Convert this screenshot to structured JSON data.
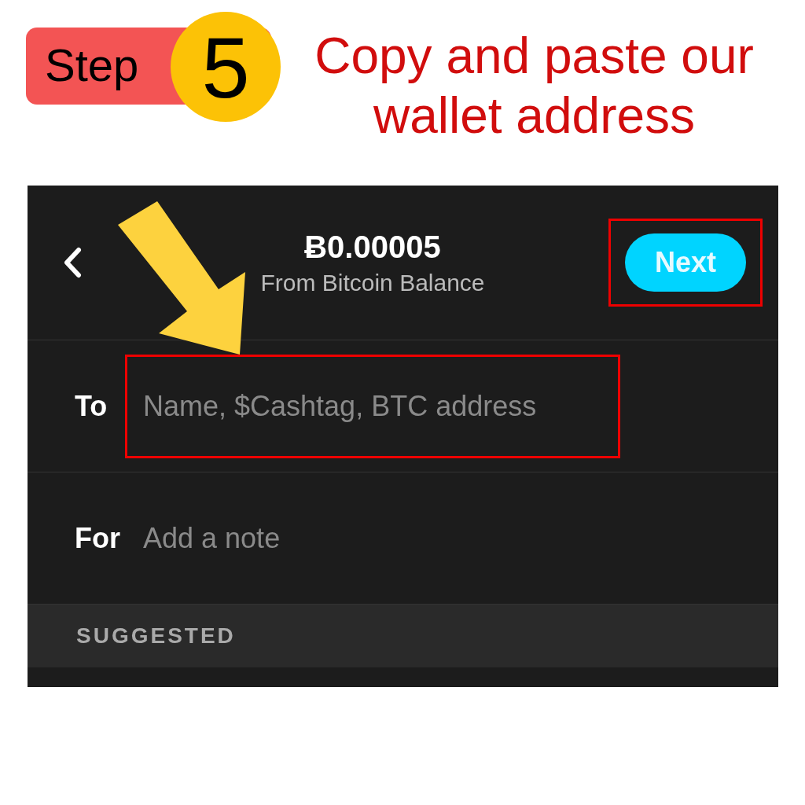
{
  "step_badge": {
    "label": "Step",
    "number": "5"
  },
  "headline": "Copy and paste our wallet address",
  "screen": {
    "amount": "Ƀ0.00005",
    "source": "From Bitcoin Balance",
    "next_button": {
      "label": "Next",
      "disabled": true,
      "highlighted": true
    },
    "fields": [
      {
        "label": "To",
        "placeholder": "Name, $Cashtag, BTC address",
        "highlighted": true
      },
      {
        "label": "For",
        "placeholder": "Add a note",
        "highlighted": false
      }
    ],
    "section_header": "SUGGESTED"
  }
}
